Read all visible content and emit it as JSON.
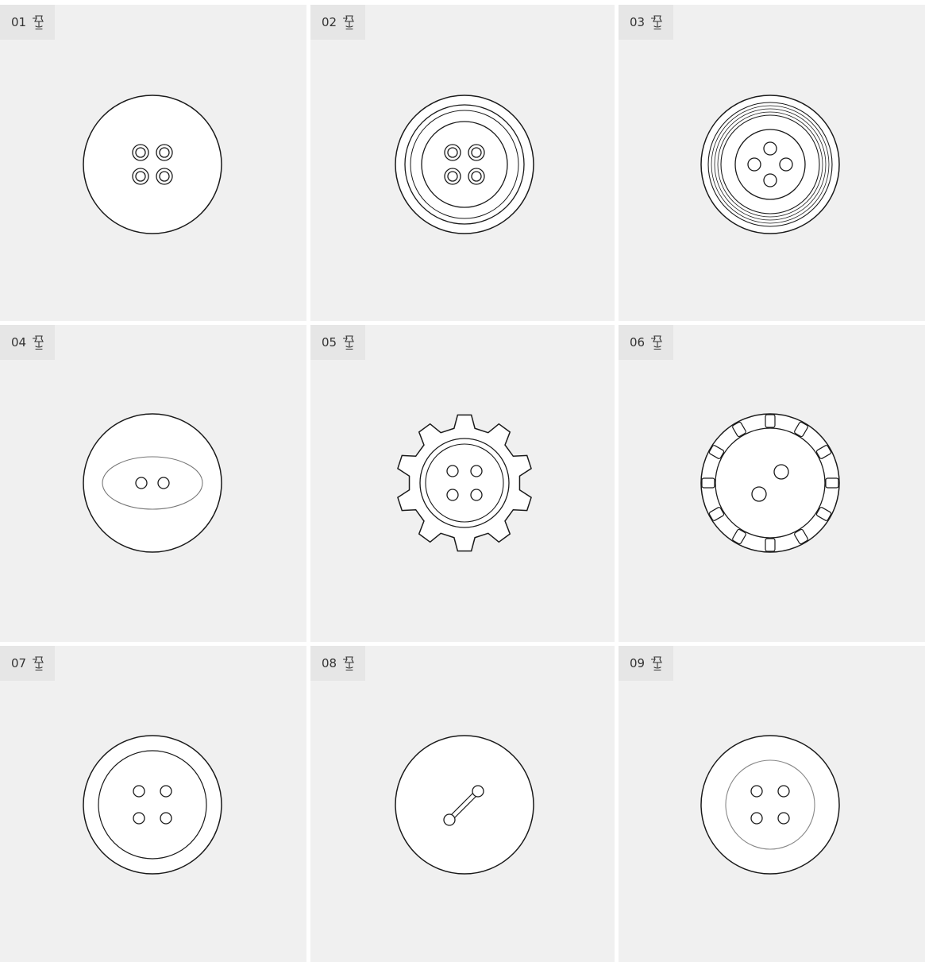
{
  "colors": {
    "background": "#f0f0f0",
    "tag_background": "#e6e6e6",
    "stroke": "#1a1a1a",
    "fill": "#ffffff"
  },
  "cells": [
    {
      "number": "01",
      "icon": "pin-icon",
      "button": "four-hole-double-ring"
    },
    {
      "number": "02",
      "icon": "pin-icon",
      "button": "four-hole-multi-rim"
    },
    {
      "number": "03",
      "icon": "pin-icon",
      "button": "four-hole-concentric"
    },
    {
      "number": "04",
      "icon": "pin-icon",
      "button": "two-hole-oval"
    },
    {
      "number": "05",
      "icon": "pin-icon",
      "button": "gear-four-hole"
    },
    {
      "number": "06",
      "icon": "pin-icon",
      "button": "notched-two-hole"
    },
    {
      "number": "07",
      "icon": "pin-icon",
      "button": "four-hole-rim"
    },
    {
      "number": "08",
      "icon": "pin-icon",
      "button": "two-hole-bar"
    },
    {
      "number": "09",
      "icon": "pin-icon",
      "button": "four-hole-thin-rim"
    }
  ]
}
